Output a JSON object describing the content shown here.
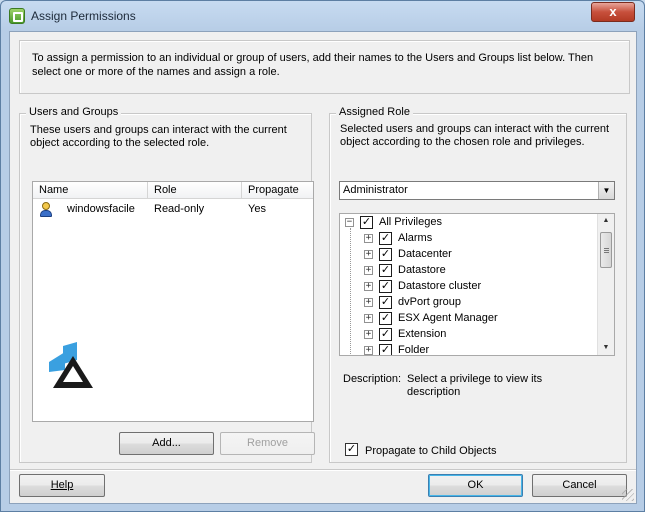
{
  "window": {
    "title": "Assign Permissions",
    "close_glyph": "x"
  },
  "intro": {
    "text": "To assign a permission to an individual or group of users, add their names to the Users and Groups list below. Then select one or more of the names and assign a role."
  },
  "users_groups": {
    "legend": "Users and Groups",
    "description": "These users and groups can interact with the current object according to the selected role.",
    "columns": [
      "Name",
      "Role",
      "Propagate"
    ],
    "rows": [
      {
        "name": "windowsfacile",
        "role": "Read-only",
        "propagate": "Yes"
      }
    ],
    "add_label": "Add...",
    "remove_label": "Remove"
  },
  "assigned_role": {
    "legend": "Assigned Role",
    "description": "Selected users and groups can interact with the current object according to the chosen role and privileges.",
    "role_selected": "Administrator",
    "privileges": {
      "root": "All Privileges",
      "items": [
        "Alarms",
        "Datacenter",
        "Datastore",
        "Datastore cluster",
        "dvPort group",
        "ESX Agent Manager",
        "Extension",
        "Folder"
      ]
    },
    "description_label": "Description:",
    "description_value": "Select a privilege to view its description",
    "propagate_label": "Propagate to Child Objects",
    "propagate_checked": true
  },
  "footer": {
    "help_label": "Help",
    "ok_label": "OK",
    "cancel_label": "Cancel"
  },
  "icons": {
    "app": "permissions-app-icon",
    "user": "user-icon",
    "watermark": "windowsfacile-logo"
  },
  "colors": {
    "titlebar": "#c7dbf1",
    "close": "#c7503c",
    "dialog_bg": "#f0f0f0",
    "default_button_border": "#3c7fb1"
  }
}
